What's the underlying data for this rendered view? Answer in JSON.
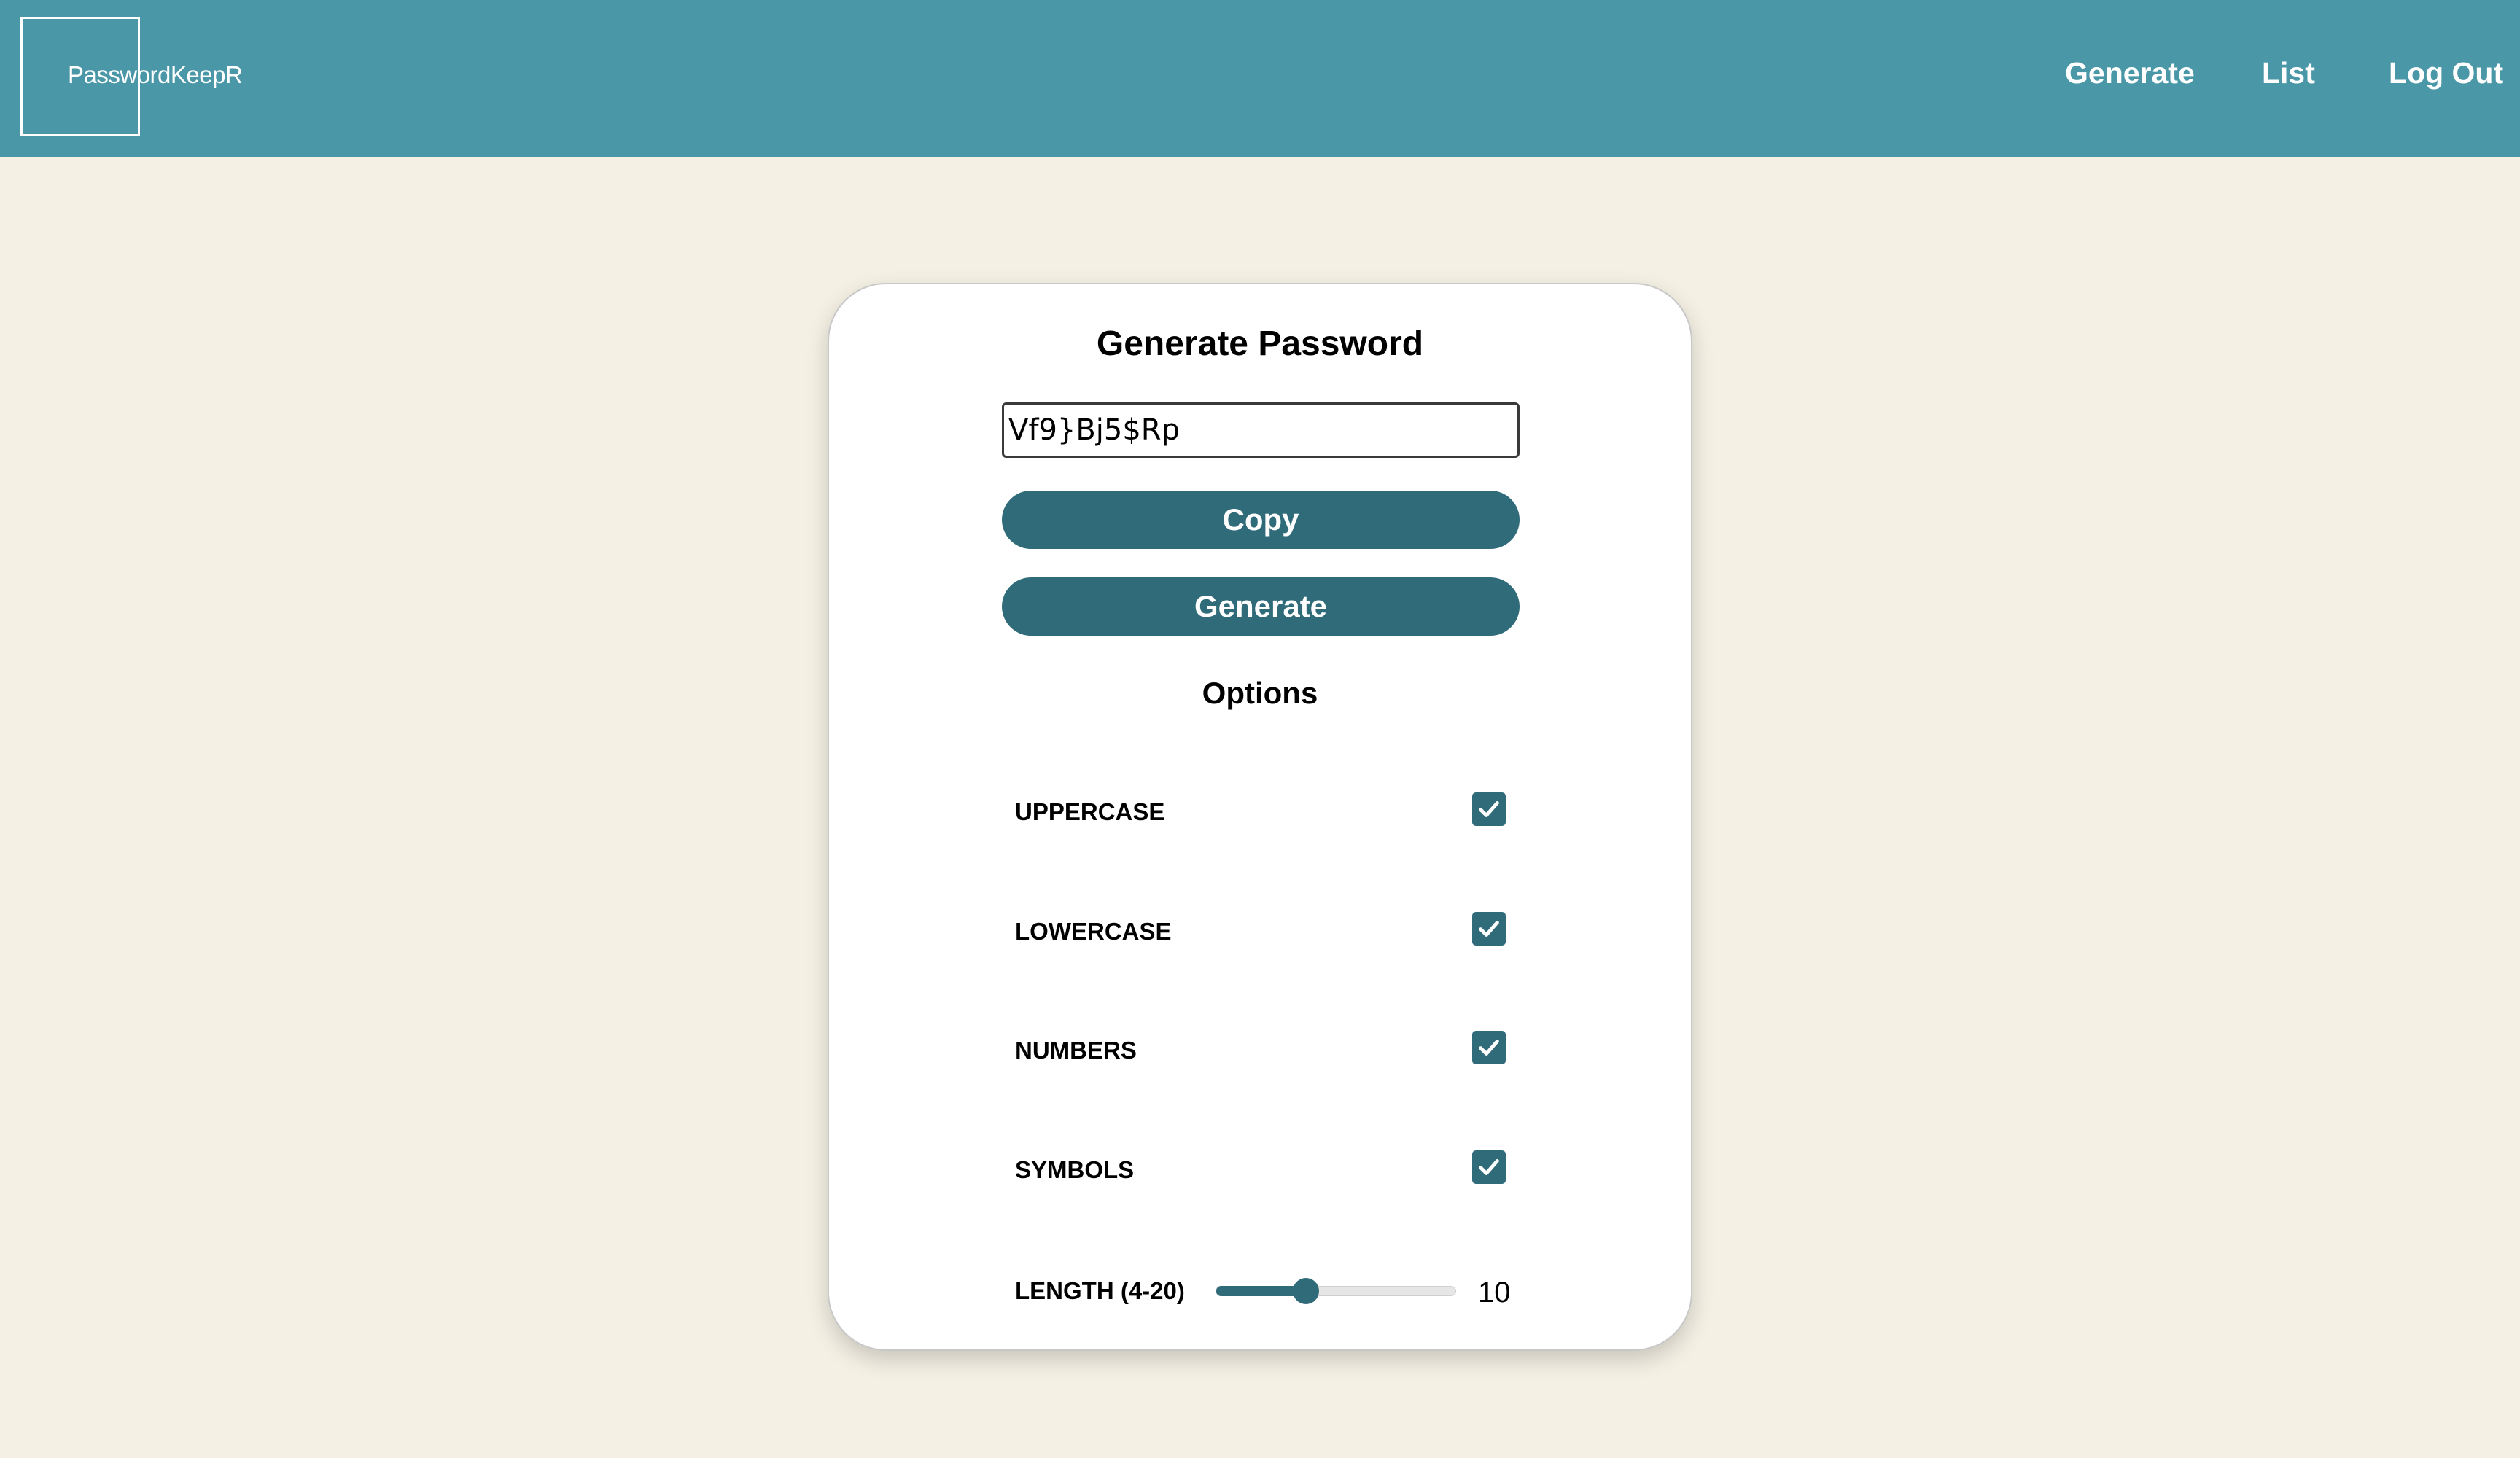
{
  "nav": {
    "logo_text": "PasswordKeepR",
    "links": [
      "Generate",
      "List",
      "Log Out"
    ]
  },
  "generator": {
    "title": "Generate Password",
    "password_value": "Vf9}Bj5$Rp",
    "copy_label": "Copy",
    "generate_label": "Generate",
    "options_title": "Options",
    "options": [
      {
        "label": "UPPERCASE",
        "checked": true
      },
      {
        "label": "LOWERCASE",
        "checked": true
      },
      {
        "label": "NUMBERS",
        "checked": true
      },
      {
        "label": "SYMBOLS",
        "checked": true
      }
    ],
    "length": {
      "label": "LENGTH (4-20)",
      "min": 4,
      "max": 20,
      "value": "10"
    }
  },
  "colors": {
    "navbar": "#4a97a8",
    "accent": "#2f6b79",
    "background": "#f4f0e4"
  },
  "icons": {
    "checkbox": "checkmark-icon"
  }
}
